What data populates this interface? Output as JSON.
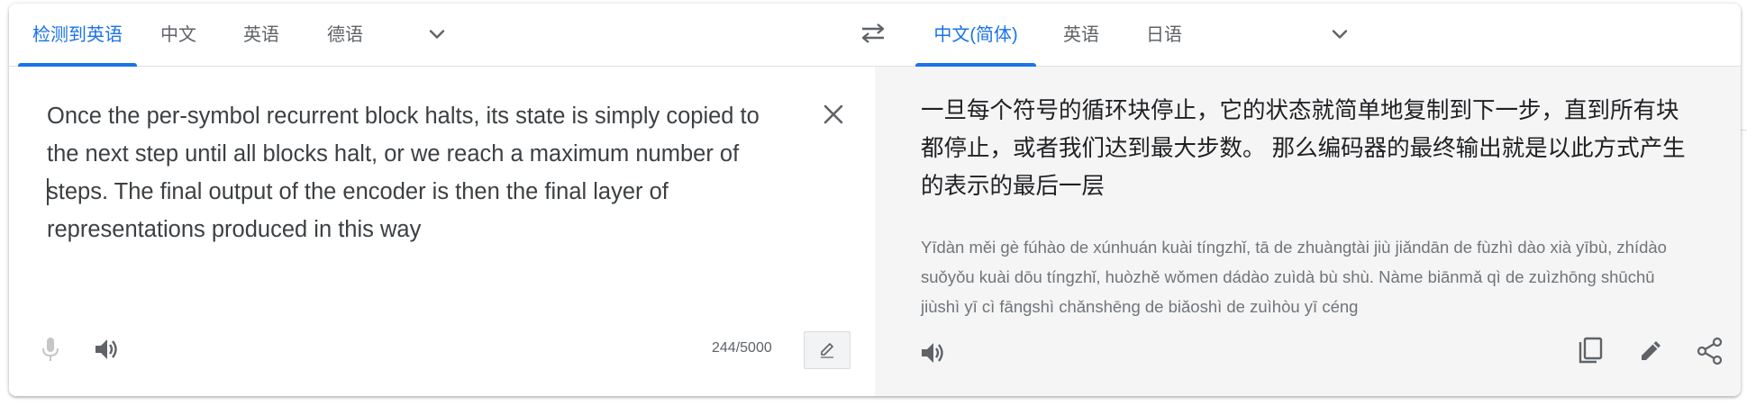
{
  "source_tabs": [
    {
      "label": "检测到英语",
      "active": true
    },
    {
      "label": "中文",
      "active": false
    },
    {
      "label": "英语",
      "active": false
    },
    {
      "label": "德语",
      "active": false
    }
  ],
  "target_tabs": [
    {
      "label": "中文(简体)",
      "active": true
    },
    {
      "label": "英语",
      "active": false
    },
    {
      "label": "日语",
      "active": false
    }
  ],
  "icons": {
    "source_more": "chevron-down-icon",
    "swap": "swap-languages-icon",
    "target_more": "chevron-down-icon",
    "clear": "close-icon",
    "mic": "microphone-icon",
    "source_listen": "speaker-icon",
    "handwrite": "pencil-icon",
    "target_listen": "speaker-icon",
    "copy": "copy-icon",
    "edit": "pencil-icon",
    "share": "share-icon"
  },
  "source": {
    "text": "Once the per-symbol recurrent block halts, its state is simply copied to the next step until all blocks halt, or we reach a maximum number of steps. The final output of the encoder is then the final layer of representations produced in this way",
    "char_count": "244/5000"
  },
  "target": {
    "text": "一旦每个符号的循环块停止，它的状态就简单地复制到下一步，直到所有块都停止，或者我们达到最大步数。 那么编码器的最终输出就是以此方式产生的表示的最后一层",
    "pinyin": "Yīdàn měi gè fúhào de xúnhuán kuài tíngzhǐ, tā de zhuàngtài jiù jiǎndān de fùzhì dào xià yībù, zhídào suǒyǒu kuài dōu tíngzhǐ, huòzhě wǒmen dádào zuìdà bù shù. Nàme biānmǎ qì de zuìzhōng shūchū jiùshì yī cì fāngshì chǎnshēng de biǎoshì de zuìhòu yī céng"
  },
  "colors": {
    "accent": "#1a73e8",
    "tab_text": "#5f6368",
    "body_text": "#3c4043",
    "target_bg": "#f5f5f5",
    "pinyin": "#70757a"
  }
}
